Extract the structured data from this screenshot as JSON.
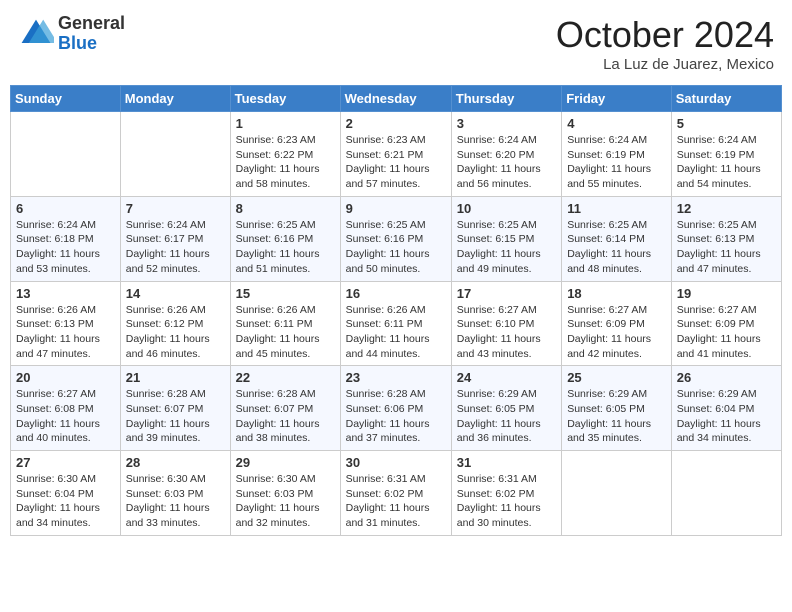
{
  "header": {
    "logo": {
      "general": "General",
      "blue": "Blue"
    },
    "title": "October 2024",
    "location": "La Luz de Juarez, Mexico"
  },
  "days_of_week": [
    "Sunday",
    "Monday",
    "Tuesday",
    "Wednesday",
    "Thursday",
    "Friday",
    "Saturday"
  ],
  "weeks": [
    [
      {
        "day": "",
        "sunrise": "",
        "sunset": "",
        "daylight": ""
      },
      {
        "day": "",
        "sunrise": "",
        "sunset": "",
        "daylight": ""
      },
      {
        "day": "1",
        "sunrise": "Sunrise: 6:23 AM",
        "sunset": "Sunset: 6:22 PM",
        "daylight": "Daylight: 11 hours and 58 minutes."
      },
      {
        "day": "2",
        "sunrise": "Sunrise: 6:23 AM",
        "sunset": "Sunset: 6:21 PM",
        "daylight": "Daylight: 11 hours and 57 minutes."
      },
      {
        "day": "3",
        "sunrise": "Sunrise: 6:24 AM",
        "sunset": "Sunset: 6:20 PM",
        "daylight": "Daylight: 11 hours and 56 minutes."
      },
      {
        "day": "4",
        "sunrise": "Sunrise: 6:24 AM",
        "sunset": "Sunset: 6:19 PM",
        "daylight": "Daylight: 11 hours and 55 minutes."
      },
      {
        "day": "5",
        "sunrise": "Sunrise: 6:24 AM",
        "sunset": "Sunset: 6:19 PM",
        "daylight": "Daylight: 11 hours and 54 minutes."
      }
    ],
    [
      {
        "day": "6",
        "sunrise": "Sunrise: 6:24 AM",
        "sunset": "Sunset: 6:18 PM",
        "daylight": "Daylight: 11 hours and 53 minutes."
      },
      {
        "day": "7",
        "sunrise": "Sunrise: 6:24 AM",
        "sunset": "Sunset: 6:17 PM",
        "daylight": "Daylight: 11 hours and 52 minutes."
      },
      {
        "day": "8",
        "sunrise": "Sunrise: 6:25 AM",
        "sunset": "Sunset: 6:16 PM",
        "daylight": "Daylight: 11 hours and 51 minutes."
      },
      {
        "day": "9",
        "sunrise": "Sunrise: 6:25 AM",
        "sunset": "Sunset: 6:16 PM",
        "daylight": "Daylight: 11 hours and 50 minutes."
      },
      {
        "day": "10",
        "sunrise": "Sunrise: 6:25 AM",
        "sunset": "Sunset: 6:15 PM",
        "daylight": "Daylight: 11 hours and 49 minutes."
      },
      {
        "day": "11",
        "sunrise": "Sunrise: 6:25 AM",
        "sunset": "Sunset: 6:14 PM",
        "daylight": "Daylight: 11 hours and 48 minutes."
      },
      {
        "day": "12",
        "sunrise": "Sunrise: 6:25 AM",
        "sunset": "Sunset: 6:13 PM",
        "daylight": "Daylight: 11 hours and 47 minutes."
      }
    ],
    [
      {
        "day": "13",
        "sunrise": "Sunrise: 6:26 AM",
        "sunset": "Sunset: 6:13 PM",
        "daylight": "Daylight: 11 hours and 47 minutes."
      },
      {
        "day": "14",
        "sunrise": "Sunrise: 6:26 AM",
        "sunset": "Sunset: 6:12 PM",
        "daylight": "Daylight: 11 hours and 46 minutes."
      },
      {
        "day": "15",
        "sunrise": "Sunrise: 6:26 AM",
        "sunset": "Sunset: 6:11 PM",
        "daylight": "Daylight: 11 hours and 45 minutes."
      },
      {
        "day": "16",
        "sunrise": "Sunrise: 6:26 AM",
        "sunset": "Sunset: 6:11 PM",
        "daylight": "Daylight: 11 hours and 44 minutes."
      },
      {
        "day": "17",
        "sunrise": "Sunrise: 6:27 AM",
        "sunset": "Sunset: 6:10 PM",
        "daylight": "Daylight: 11 hours and 43 minutes."
      },
      {
        "day": "18",
        "sunrise": "Sunrise: 6:27 AM",
        "sunset": "Sunset: 6:09 PM",
        "daylight": "Daylight: 11 hours and 42 minutes."
      },
      {
        "day": "19",
        "sunrise": "Sunrise: 6:27 AM",
        "sunset": "Sunset: 6:09 PM",
        "daylight": "Daylight: 11 hours and 41 minutes."
      }
    ],
    [
      {
        "day": "20",
        "sunrise": "Sunrise: 6:27 AM",
        "sunset": "Sunset: 6:08 PM",
        "daylight": "Daylight: 11 hours and 40 minutes."
      },
      {
        "day": "21",
        "sunrise": "Sunrise: 6:28 AM",
        "sunset": "Sunset: 6:07 PM",
        "daylight": "Daylight: 11 hours and 39 minutes."
      },
      {
        "day": "22",
        "sunrise": "Sunrise: 6:28 AM",
        "sunset": "Sunset: 6:07 PM",
        "daylight": "Daylight: 11 hours and 38 minutes."
      },
      {
        "day": "23",
        "sunrise": "Sunrise: 6:28 AM",
        "sunset": "Sunset: 6:06 PM",
        "daylight": "Daylight: 11 hours and 37 minutes."
      },
      {
        "day": "24",
        "sunrise": "Sunrise: 6:29 AM",
        "sunset": "Sunset: 6:05 PM",
        "daylight": "Daylight: 11 hours and 36 minutes."
      },
      {
        "day": "25",
        "sunrise": "Sunrise: 6:29 AM",
        "sunset": "Sunset: 6:05 PM",
        "daylight": "Daylight: 11 hours and 35 minutes."
      },
      {
        "day": "26",
        "sunrise": "Sunrise: 6:29 AM",
        "sunset": "Sunset: 6:04 PM",
        "daylight": "Daylight: 11 hours and 34 minutes."
      }
    ],
    [
      {
        "day": "27",
        "sunrise": "Sunrise: 6:30 AM",
        "sunset": "Sunset: 6:04 PM",
        "daylight": "Daylight: 11 hours and 34 minutes."
      },
      {
        "day": "28",
        "sunrise": "Sunrise: 6:30 AM",
        "sunset": "Sunset: 6:03 PM",
        "daylight": "Daylight: 11 hours and 33 minutes."
      },
      {
        "day": "29",
        "sunrise": "Sunrise: 6:30 AM",
        "sunset": "Sunset: 6:03 PM",
        "daylight": "Daylight: 11 hours and 32 minutes."
      },
      {
        "day": "30",
        "sunrise": "Sunrise: 6:31 AM",
        "sunset": "Sunset: 6:02 PM",
        "daylight": "Daylight: 11 hours and 31 minutes."
      },
      {
        "day": "31",
        "sunrise": "Sunrise: 6:31 AM",
        "sunset": "Sunset: 6:02 PM",
        "daylight": "Daylight: 11 hours and 30 minutes."
      },
      {
        "day": "",
        "sunrise": "",
        "sunset": "",
        "daylight": ""
      },
      {
        "day": "",
        "sunrise": "",
        "sunset": "",
        "daylight": ""
      }
    ]
  ]
}
